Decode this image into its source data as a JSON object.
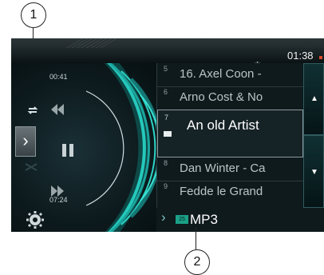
{
  "callouts": {
    "top": "1",
    "bottom": "2"
  },
  "status_bar": {
    "clock": "01:38"
  },
  "player": {
    "elapsed": "00:41",
    "total": "07:24"
  },
  "playlist": {
    "rows": [
      {
        "num": "5",
        "title": "16. Axel Coon -"
      },
      {
        "num": "6",
        "title": "Arno Cost & No"
      },
      {
        "num": "7",
        "title": "An old  Artist",
        "active": true
      },
      {
        "num": "8",
        "title": "Dan Winter - Ca"
      },
      {
        "num": "9",
        "title": "Fedde le Grand"
      }
    ]
  },
  "source": {
    "badge": "25",
    "label": "MP3"
  },
  "colors": {
    "accent": "#1ec3b3",
    "background": "#0c1417",
    "text": "#ffffff"
  },
  "icons": {
    "repeat": "repeat-icon",
    "previous": "skip-back-icon",
    "pause": "pause-icon",
    "shuffle": "shuffle-icon",
    "next": "skip-forward-icon",
    "settings": "gear-icon",
    "bluetooth": "bluetooth-icon",
    "scroll_up": "arrow-up-icon",
    "scroll_down": "arrow-down-icon"
  }
}
